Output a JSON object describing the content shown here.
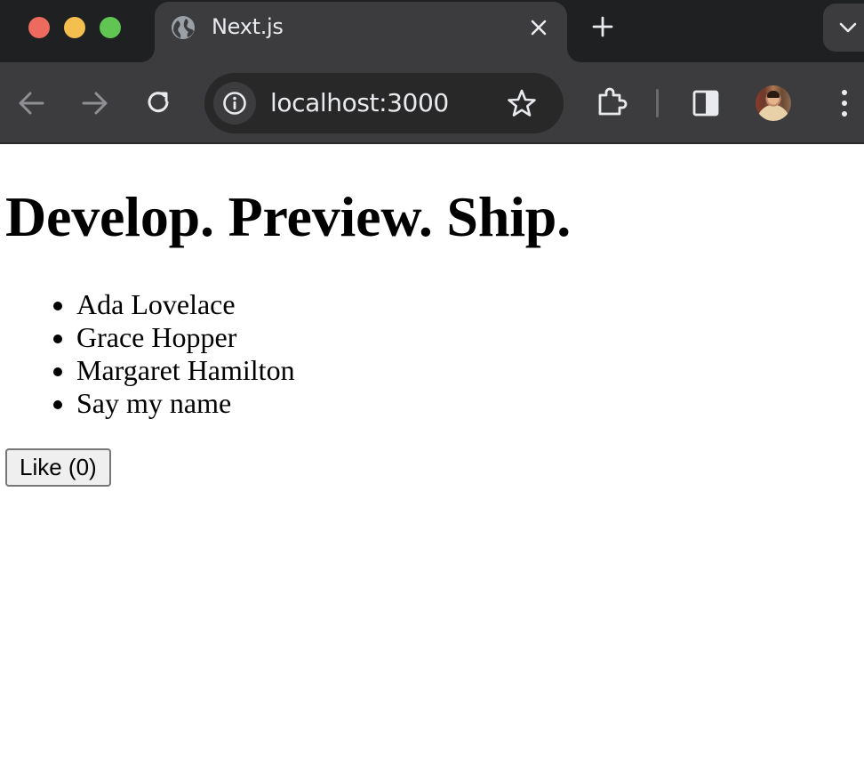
{
  "browser": {
    "tab": {
      "title": "Next.js",
      "icon": "globe-icon"
    },
    "address_bar": {
      "url": "localhost:3000"
    },
    "icons": {
      "back": "arrow-left-icon",
      "forward": "arrow-right-icon",
      "reload": "reload-icon",
      "site_info": "info-icon",
      "bookmark": "star-icon",
      "extensions": "puzzle-icon",
      "side_panel": "side-panel-icon",
      "menu": "kebab-menu-icon",
      "new_tab": "plus-icon",
      "tab_search": "chevron-down-icon"
    },
    "colors": {
      "tabstrip_bg": "#1f2022",
      "toolbar_bg": "#3c3c3e",
      "close_dot": "#ed6a5e",
      "minimize_dot": "#f5bf4f",
      "maximize_dot": "#61c554"
    }
  },
  "page": {
    "heading": "Develop. Preview. Ship.",
    "names": [
      "Ada Lovelace",
      "Grace Hopper",
      "Margaret Hamilton",
      "Say my name"
    ],
    "like_button": "Like (0)"
  }
}
